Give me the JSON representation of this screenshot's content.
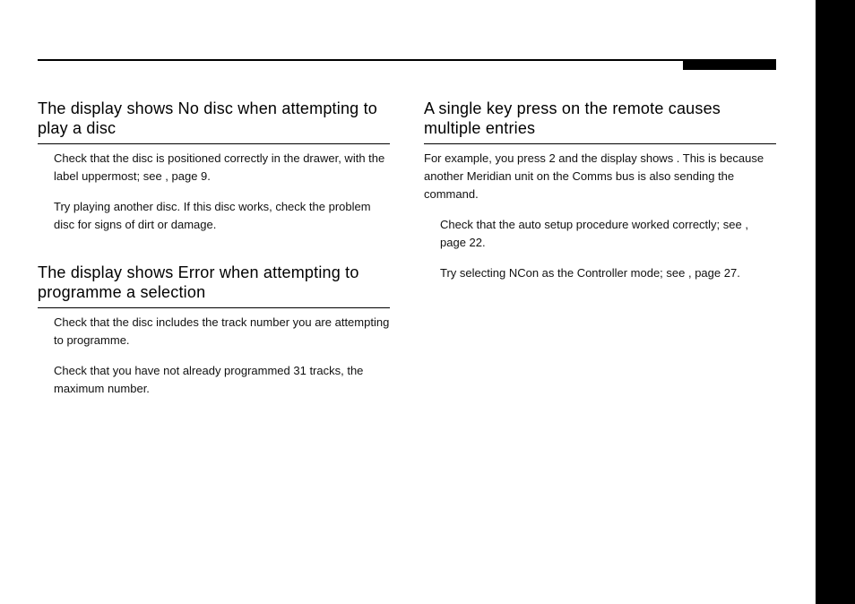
{
  "left": {
    "section1": {
      "title": "The display shows No disc when attempting to play a disc",
      "bullets": [
        "Check that the disc is positioned correctly in the drawer, with the label uppermost; see                         , page 9.",
        "Try playing another disc. If this disc works, check the problem disc for signs of dirt or damage."
      ]
    },
    "section2": {
      "title": "The display shows Error when attempting to programme a selection",
      "bullets": [
        "Check that the disc includes the track number you are attempting to programme.",
        "Check that you have not already programmed 31 tracks, the maximum number."
      ]
    }
  },
  "right": {
    "section1": {
      "title": "A single key press on the remote causes multiple entries",
      "intro": "For example, you press 2 and the display shows              . This is because another Meridian unit on the Comms bus is also sending the command.",
      "bullets": [
        "Check that the auto setup procedure worked correctly; see                                                                                    , page 22.",
        "Try selecting NCon as the Controller mode; see                                               , page 27."
      ]
    }
  }
}
